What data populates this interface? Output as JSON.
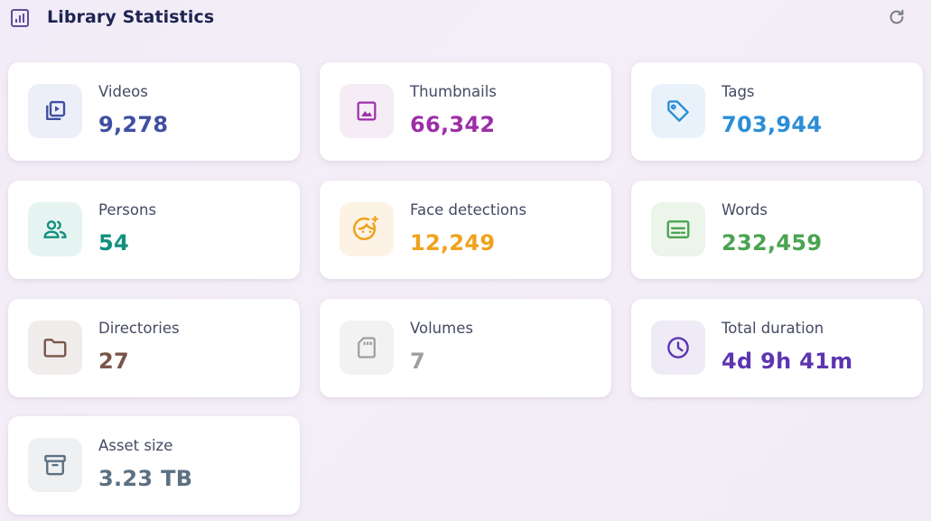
{
  "header": {
    "title": "Library Statistics",
    "icon": "bar-chart-icon",
    "refresh_icon": "refresh-icon"
  },
  "stats": [
    {
      "label": "Videos",
      "value": "9,278",
      "icon": "video-library-icon",
      "color": "#3f4fa3",
      "bg": "#eceff8"
    },
    {
      "label": "Thumbnails",
      "value": "66,342",
      "icon": "image-icon",
      "color": "#9c2fa8",
      "bg": "#f5ecf6"
    },
    {
      "label": "Tags",
      "value": "703,944",
      "icon": "tag-icon",
      "color": "#2b8ed6",
      "bg": "#e9f2fb"
    },
    {
      "label": "Persons",
      "value": "54",
      "icon": "people-icon",
      "color": "#12907f",
      "bg": "#e6f4f1"
    },
    {
      "label": "Face detections",
      "value": "12,249",
      "icon": "face-icon",
      "color": "#f0a21c",
      "bg": "#fdf3e5"
    },
    {
      "label": "Words",
      "value": "232,459",
      "icon": "subtitles-icon",
      "color": "#4aa450",
      "bg": "#ebf5ea"
    },
    {
      "label": "Directories",
      "value": "27",
      "icon": "folder-icon",
      "color": "#795548",
      "bg": "#efeceb"
    },
    {
      "label": "Volumes",
      "value": "7",
      "icon": "sd-card-icon",
      "color": "#9e9e9e",
      "bg": "#f2f2f3"
    },
    {
      "label": "Total duration",
      "value": "4d 9h 41m",
      "icon": "clock-icon",
      "color": "#5e35b1",
      "bg": "#eeeaf6"
    },
    {
      "label": "Asset size",
      "value": "3.23 TB",
      "icon": "archive-icon",
      "color": "#5b7082",
      "bg": "#eef0f2"
    }
  ]
}
